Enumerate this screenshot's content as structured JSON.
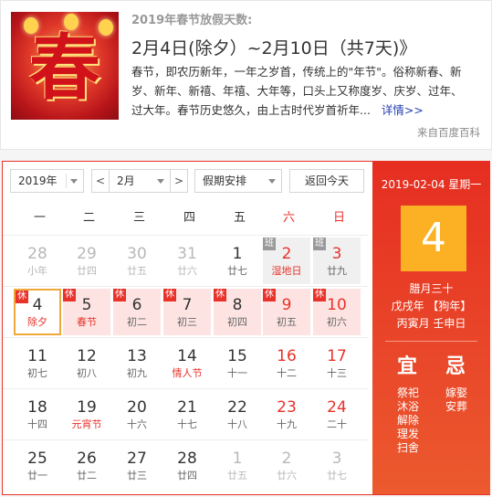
{
  "card": {
    "image_text": "春",
    "subtitle": "2019年春节放假天数:",
    "title": "2月4日(除夕）~2月10日（共7天)",
    "title_arrow": "》",
    "desc_lines": [
      "春节，即农历新年，一年之岁首，传统上的\"年节\"。俗称新春、新",
      "岁、新年、新禧、年禧、大年等，口头上又称度岁、庆岁、过年、",
      "过大年。春节历史悠久，由上古时代岁首祈年..."
    ],
    "more_label": "详情>>",
    "source": "来自百度百科"
  },
  "toolbar": {
    "year": "2019年",
    "prev": "<",
    "month": "2月",
    "next": ">",
    "holiday": "假期安排",
    "today": "返回今天"
  },
  "weekdays": [
    "一",
    "二",
    "三",
    "四",
    "五",
    "六",
    "日"
  ],
  "rows": [
    [
      {
        "d": "28",
        "l": "小年",
        "other": true
      },
      {
        "d": "29",
        "l": "廿四",
        "other": true
      },
      {
        "d": "30",
        "l": "廿五",
        "other": true
      },
      {
        "d": "31",
        "l": "廿六",
        "other": true
      },
      {
        "d": "1",
        "l": "廿七"
      },
      {
        "d": "2",
        "l": "湿地日",
        "weekend": true,
        "badge": "班",
        "festival": true
      },
      {
        "d": "3",
        "l": "廿九",
        "weekend": true,
        "badge": "班"
      }
    ],
    [
      {
        "d": "4",
        "l": "除夕",
        "badge": "休",
        "selected": true,
        "festival": true
      },
      {
        "d": "5",
        "l": "春节",
        "badge": "休",
        "festival": true
      },
      {
        "d": "6",
        "l": "初二",
        "badge": "休"
      },
      {
        "d": "7",
        "l": "初三",
        "badge": "休"
      },
      {
        "d": "8",
        "l": "初四",
        "badge": "休"
      },
      {
        "d": "9",
        "l": "初五",
        "badge": "休",
        "weekend": true
      },
      {
        "d": "10",
        "l": "初六",
        "badge": "休",
        "weekend": true
      }
    ],
    [
      {
        "d": "11",
        "l": "初七"
      },
      {
        "d": "12",
        "l": "初八"
      },
      {
        "d": "13",
        "l": "初九"
      },
      {
        "d": "14",
        "l": "情人节",
        "festival": true
      },
      {
        "d": "15",
        "l": "十一"
      },
      {
        "d": "16",
        "l": "十二",
        "weekend": true
      },
      {
        "d": "17",
        "l": "十三",
        "weekend": true
      }
    ],
    [
      {
        "d": "18",
        "l": "十四"
      },
      {
        "d": "19",
        "l": "元宵节",
        "festival": true
      },
      {
        "d": "20",
        "l": "十六"
      },
      {
        "d": "21",
        "l": "十七"
      },
      {
        "d": "22",
        "l": "十八"
      },
      {
        "d": "23",
        "l": "十九",
        "weekend": true
      },
      {
        "d": "24",
        "l": "二十",
        "weekend": true
      }
    ],
    [
      {
        "d": "25",
        "l": "廿一"
      },
      {
        "d": "26",
        "l": "廿二"
      },
      {
        "d": "27",
        "l": "廿三"
      },
      {
        "d": "28",
        "l": "廿四"
      },
      {
        "d": "1",
        "l": "廿五",
        "other": true
      },
      {
        "d": "2",
        "l": "廿六",
        "other": true
      },
      {
        "d": "3",
        "l": "廿七",
        "other": true
      }
    ]
  ],
  "side": {
    "date": "2019-02-04 星期一",
    "day": "4",
    "lunar_date": "腊月三十",
    "ganzhi_year": "戊戌年 【狗年】",
    "ganzhi_month_day": "丙寅月 壬申日",
    "yi_label": "宜",
    "ji_label": "忌",
    "yi": [
      "祭祀",
      "沐浴",
      "解除",
      "理发",
      "扫舍"
    ],
    "ji": [
      "嫁娶",
      "安葬"
    ]
  },
  "colors": {
    "accent": "#e8322a",
    "selected_border": "#f0a83a",
    "big_day_bg": "#fbb123",
    "rest_bg": "#fde4e2",
    "link": "#2440b3"
  }
}
